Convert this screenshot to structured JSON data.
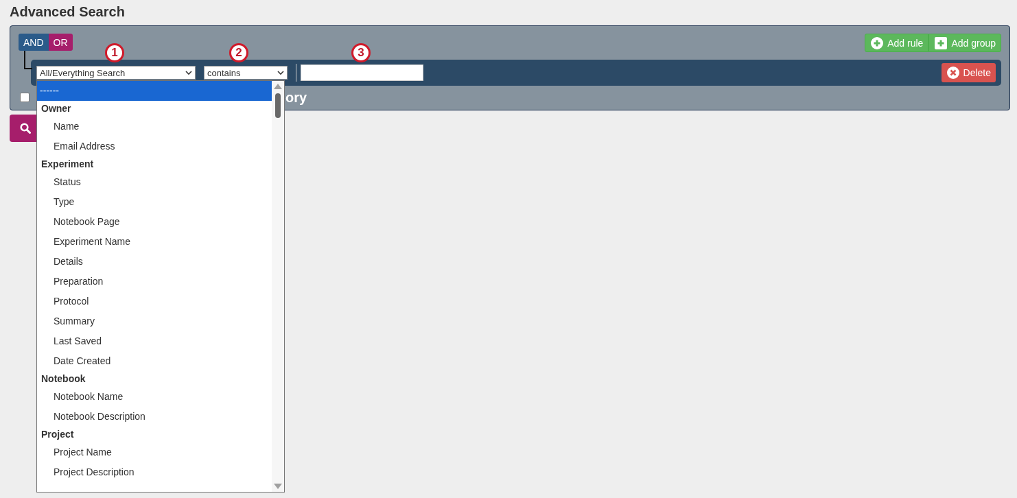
{
  "title": "Advanced Search",
  "conditions": [
    {
      "label": "AND",
      "selected": true
    },
    {
      "label": "OR",
      "selected": false
    }
  ],
  "group_buttons": [
    {
      "kind": "rule",
      "label": "Add rule"
    },
    {
      "kind": "group",
      "label": "Add group"
    }
  ],
  "rule": {
    "field": "All/Everything Search",
    "operator": "contains",
    "delete_label": "Delete"
  },
  "annotations": [
    "1",
    "2",
    "3"
  ],
  "checkbox": {
    "checked": false,
    "label": "ory"
  },
  "field_options": [
    {
      "kind": "option",
      "label": "------",
      "selected": true
    },
    {
      "kind": "group",
      "label": "Owner"
    },
    {
      "kind": "option",
      "label": "Name",
      "selected": false
    },
    {
      "kind": "option",
      "label": "Email Address",
      "selected": false
    },
    {
      "kind": "group",
      "label": "Experiment"
    },
    {
      "kind": "option",
      "label": "Status",
      "selected": false
    },
    {
      "kind": "option",
      "label": "Type",
      "selected": false
    },
    {
      "kind": "option",
      "label": "Notebook Page",
      "selected": false
    },
    {
      "kind": "option",
      "label": "Experiment Name",
      "selected": false
    },
    {
      "kind": "option",
      "label": "Details",
      "selected": false
    },
    {
      "kind": "option",
      "label": "Preparation",
      "selected": false
    },
    {
      "kind": "option",
      "label": "Protocol",
      "selected": false
    },
    {
      "kind": "option",
      "label": "Summary",
      "selected": false
    },
    {
      "kind": "option",
      "label": "Last Saved",
      "selected": false
    },
    {
      "kind": "option",
      "label": "Date Created",
      "selected": false
    },
    {
      "kind": "group",
      "label": "Notebook"
    },
    {
      "kind": "option",
      "label": "Notebook Name",
      "selected": false
    },
    {
      "kind": "option",
      "label": "Notebook Description",
      "selected": false
    },
    {
      "kind": "group",
      "label": "Project"
    },
    {
      "kind": "option",
      "label": "Project Name",
      "selected": false
    },
    {
      "kind": "option",
      "label": "Project Description",
      "selected": false
    }
  ]
}
